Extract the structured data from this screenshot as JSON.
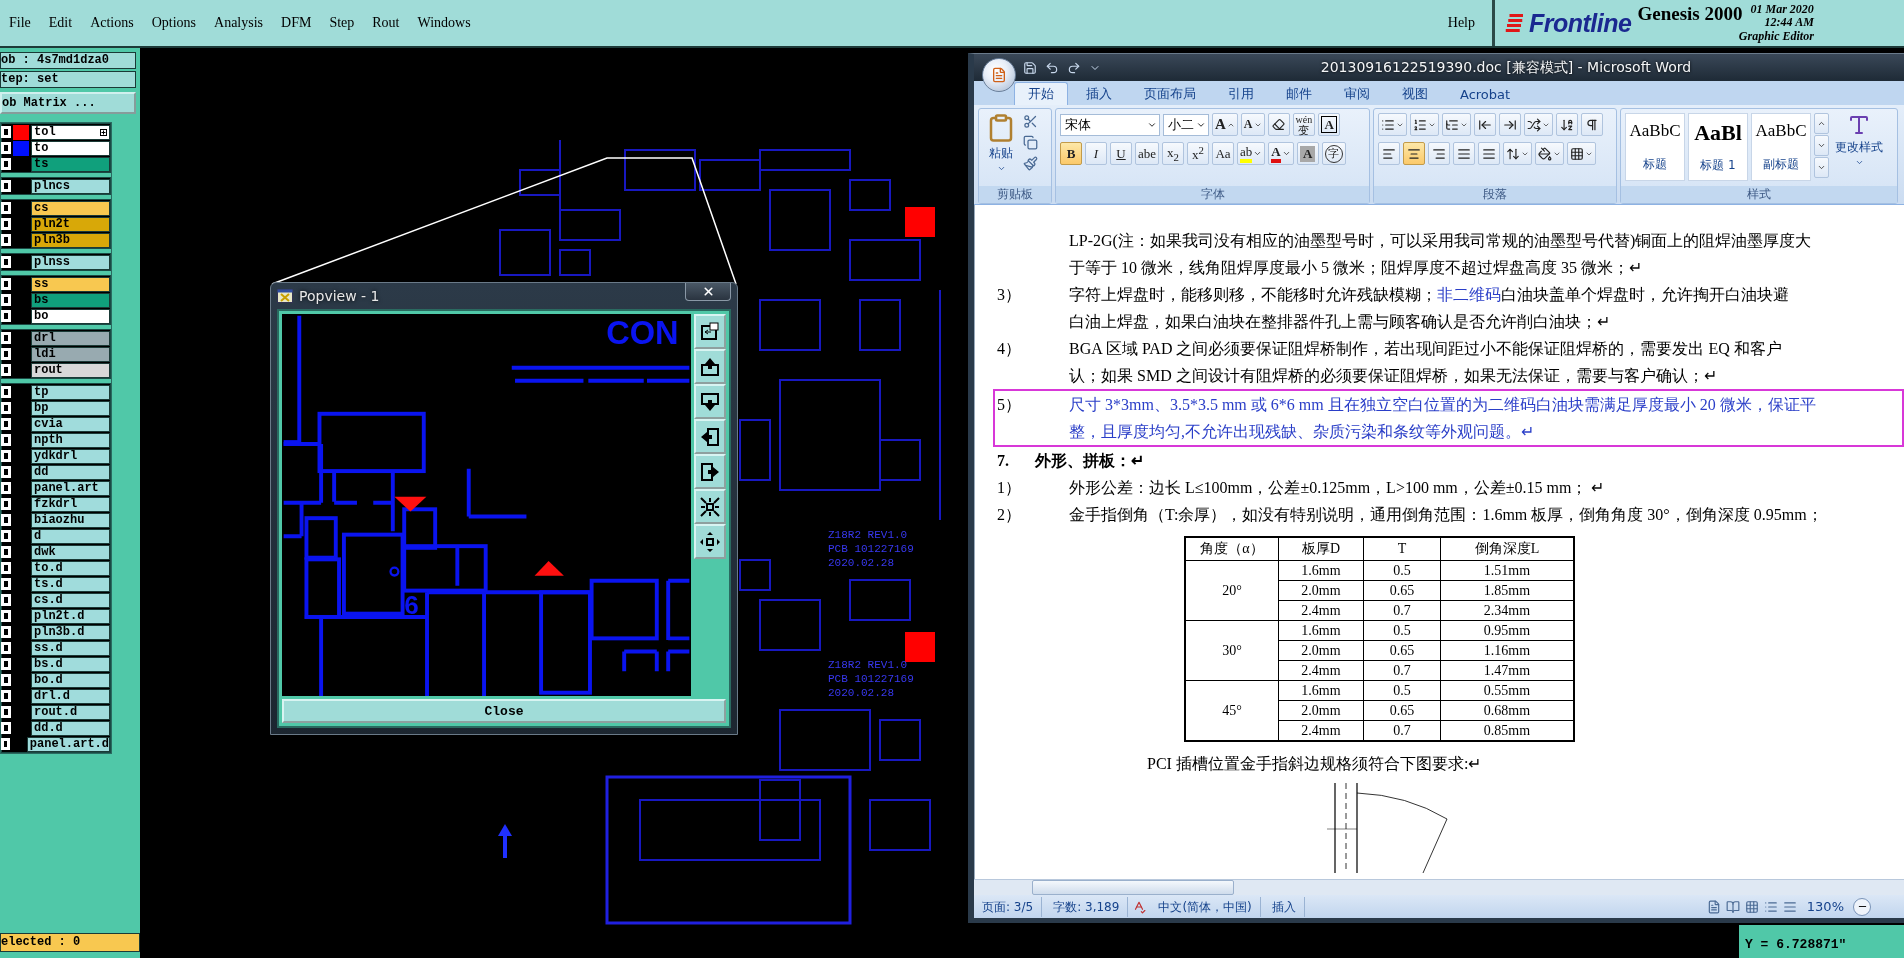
{
  "menu_bar": {
    "items": [
      "File",
      "Edit",
      "Actions",
      "Options",
      "Analysis",
      "DFM",
      "Step",
      "Rout",
      "Windows"
    ],
    "help": "Help"
  },
  "brand": {
    "logo": "Frontline",
    "product": "Genesis 2000",
    "date": "01 Mar 2020",
    "time": "12:44 AM",
    "subtitle": "Graphic Editor"
  },
  "left_panel": {
    "job": "ob : 4s7md1dza0",
    "step": "tep: set",
    "matrix_button": "ob Matrix ...",
    "layer_groups": [
      [
        {
          "name": "tol",
          "color": "#ffffff",
          "swatch": {
            "color": "#ff0000"
          },
          "expander": true,
          "checked": false
        },
        {
          "name": "to",
          "color": "#ffffff",
          "swatch": {
            "color": "#0010ff"
          },
          "expander": false,
          "checked": false
        },
        {
          "name": "ts",
          "color": "#10a07c",
          "expander": false,
          "checked": false
        }
      ],
      [
        {
          "name": "plncs",
          "color": "#a0dcdc",
          "expander": false,
          "checked": false
        }
      ],
      [
        {
          "name": "cs",
          "color": "#f8c850",
          "expander": false,
          "checked": false
        },
        {
          "name": "pln2t",
          "color": "#d8a808",
          "expander": false,
          "checked": false
        },
        {
          "name": "pln3b",
          "color": "#d8a808",
          "expander": false,
          "checked": false
        }
      ],
      [
        {
          "name": "plnss",
          "color": "#a0dcdc",
          "expander": false,
          "checked": false
        }
      ],
      [
        {
          "name": "ss",
          "color": "#f8c850",
          "expander": false,
          "checked": false
        },
        {
          "name": "bs",
          "color": "#10a07c",
          "expander": false,
          "checked": false
        },
        {
          "name": "bo",
          "color": "#ffffff",
          "expander": false,
          "checked": false
        }
      ],
      [
        {
          "name": "drl",
          "color": "#98aab0",
          "expander": false,
          "checked": false
        },
        {
          "name": "ldi",
          "color": "#98aab0",
          "expander": false,
          "checked": false
        },
        {
          "name": "rout",
          "color": "#d8d8d8",
          "expander": false,
          "checked": false
        }
      ],
      [
        {
          "name": "tp",
          "color": "#a0dcdc",
          "expander": false,
          "checked": false
        },
        {
          "name": "bp",
          "color": "#a0dcdc",
          "expander": false,
          "checked": false
        },
        {
          "name": "cvia",
          "color": "#a0dcdc",
          "expander": false,
          "checked": false
        },
        {
          "name": "npth",
          "color": "#a0dcdc",
          "expander": false,
          "checked": false
        },
        {
          "name": "ydkdrl",
          "color": "#a0dcdc",
          "expander": false,
          "checked": false
        },
        {
          "name": "dd",
          "color": "#a0dcdc",
          "expander": false,
          "checked": false
        },
        {
          "name": "panel.art",
          "color": "#a0dcdc",
          "expander": false,
          "checked": false
        },
        {
          "name": "fzkdrl",
          "color": "#a0dcdc",
          "expander": false,
          "checked": false
        },
        {
          "name": "biaozhu",
          "color": "#a0dcdc",
          "expander": false,
          "checked": false
        },
        {
          "name": "d",
          "color": "#a0dcdc",
          "expander": false,
          "checked": false
        },
        {
          "name": "dwk",
          "color": "#a0dcdc",
          "expander": false,
          "checked": false
        },
        {
          "name": "to.d",
          "color": "#a0dcdc",
          "expander": false,
          "checked": false
        },
        {
          "name": "ts.d",
          "color": "#a0dcdc",
          "expander": false,
          "checked": false
        },
        {
          "name": "cs.d",
          "color": "#a0dcdc",
          "expander": false,
          "checked": false
        },
        {
          "name": "pln2t.d",
          "color": "#a0dcdc",
          "expander": false,
          "checked": false
        },
        {
          "name": "pln3b.d",
          "color": "#a0dcdc",
          "expander": false,
          "checked": false
        },
        {
          "name": "ss.d",
          "color": "#a0dcdc",
          "expander": false,
          "checked": false
        },
        {
          "name": "bs.d",
          "color": "#a0dcdc",
          "expander": false,
          "checked": false
        },
        {
          "name": "bo.d",
          "color": "#a0dcdc",
          "expander": false,
          "checked": false
        },
        {
          "name": "drl.d",
          "color": "#a0dcdc",
          "expander": false,
          "checked": false
        },
        {
          "name": "rout.d",
          "color": "#a0dcdc",
          "expander": false,
          "checked": false
        },
        {
          "name": "dd.d",
          "color": "#a0dcdc",
          "expander": false,
          "checked": false
        },
        {
          "name": "panel.art.d",
          "color": "#a0dcdc",
          "expander": false,
          "checked": false
        }
      ]
    ],
    "selected": "elected : 0"
  },
  "canvas": {
    "board_labels": [
      {
        "lines": [
          "Z18R2 REV1.0",
          "PCB 101227169",
          "2020.02.28"
        ]
      },
      {
        "lines": [
          "Z18R2 REV1.0",
          "PCB 101227169",
          "2020.02.28"
        ]
      }
    ]
  },
  "popview": {
    "title": "Popview - 1",
    "labels": [
      "CON",
      "6"
    ],
    "close_button": "Close"
  },
  "word": {
    "title": "20130916122519390.doc [兼容模式] - Microsoft Word",
    "tabs": [
      {
        "label": "开始",
        "selected": true
      },
      {
        "label": "插入",
        "selected": false
      },
      {
        "label": "页面布局",
        "selected": false
      },
      {
        "label": "引用",
        "selected": false
      },
      {
        "label": "邮件",
        "selected": false
      },
      {
        "label": "审阅",
        "selected": false
      },
      {
        "label": "视图",
        "selected": false
      },
      {
        "label": "Acrobat",
        "selected": false
      }
    ],
    "ribbon": {
      "clipboard": {
        "label": "剪贴板",
        "paste": "粘贴"
      },
      "font": {
        "label": "字体",
        "name": "宋体",
        "size": "小二",
        "size_buttons": [
          "A",
          "A"
        ],
        "phonetic": "wén",
        "phonetic_base": "变",
        "border_button": "A",
        "toggles": [
          {
            "text": "B",
            "kind": "bold",
            "on": true
          },
          {
            "text": "I",
            "kind": "italic",
            "on": false
          },
          {
            "text": "U",
            "kind": "underline",
            "on": false
          },
          {
            "text": "abe",
            "kind": "strike",
            "on": false
          },
          {
            "text": "x$_{2}$",
            "kind": "plain",
            "on": false
          },
          {
            "text": "x$^{2}$",
            "kind": "plain",
            "on": false
          },
          {
            "text": "Aa",
            "kind": "plain",
            "on": false
          }
        ],
        "color_buttons": [
          {
            "text": "ab",
            "kind": "highlight"
          },
          {
            "text": "A",
            "kind": "font-color"
          },
          {
            "text": "A",
            "kind": "shading"
          },
          {
            "text": "字",
            "kind": "enclose"
          }
        ]
      },
      "paragraph": {
        "label": "段落",
        "alignments": [
          {
            "kind": "left",
            "selected": false
          },
          {
            "kind": "center",
            "selected": true
          },
          {
            "kind": "right",
            "selected": false
          },
          {
            "kind": "justify",
            "selected": false
          },
          {
            "kind": "distributed",
            "selected": false
          }
        ]
      },
      "styles": {
        "label": "样式",
        "items": [
          {
            "preview": "AaBbC",
            "label": "标题",
            "kind": "title"
          },
          {
            "preview": "AaBl",
            "label": "标题 1",
            "kind": "heading"
          },
          {
            "preview": "AaBbC",
            "label": "副标题",
            "kind": "subtitle"
          }
        ],
        "change": "更改样式"
      }
    },
    "document": {
      "paragraphs": [
        {
          "kind": "continuation",
          "framed": false,
          "lines": [
            [
              {
                "text": "LP-2G(注：如果我司没有相应的油墨型号时，可以采用我司常规的油墨型号代替)铜面上的阻焊油墨厚度大",
                "blue": false
              }
            ],
            [
              {
                "text": "于等于 10 微米，线角阻焊厚度最小 5 微米；阻焊厚度不超过焊盘高度 35 微米；↵",
                "blue": false
              }
            ]
          ]
        },
        {
          "kind": "item",
          "number": "3）",
          "framed": false,
          "lines": [
            [
              {
                "text": "字符上焊盘时，能移则移，不能移时允许残缺模糊；",
                "blue": false
              },
              {
                "text": "非二维码",
                "blue": true
              },
              {
                "text": "白油块盖单个焊盘时，允许掏开白油块避",
                "blue": false
              }
            ],
            [
              {
                "text": "白油上焊盘，如果白油块在整排器件孔上需与顾客确认是否允许削白油块；↵",
                "blue": false
              }
            ]
          ]
        },
        {
          "kind": "item",
          "number": "4）",
          "framed": false,
          "lines": [
            [
              {
                "text": "BGA 区域 PAD 之间必须要保证阻焊桥制作，若出现间距过小不能保证阻焊桥的，需要发出 EQ 和客户",
                "blue": false
              }
            ],
            [
              {
                "text": "认；如果 SMD 之间设计有阻焊桥的必须要保证阻焊桥，如果无法保证，需要与客户确认；↵",
                "blue": false
              }
            ]
          ]
        },
        {
          "kind": "item",
          "number": "5）",
          "framed": true,
          "lines": [
            [
              {
                "text": "尺寸 3*3mm、3.5*3.5 mm 或 6*6 mm 且在独立空白位置的为二维码白油块需满足厚度最小 20 微米，保证平",
                "blue": true
              }
            ],
            [
              {
                "text": "整，且厚度均匀,不允许出现残缺、杂质污染和条纹等外观问题。↵",
                "blue": true
              }
            ]
          ]
        },
        {
          "kind": "heading",
          "number": "7.",
          "framed": false,
          "lines": [
            [
              {
                "text": "外形、拼板：↵",
                "blue": false
              }
            ]
          ]
        },
        {
          "kind": "item",
          "number": "1）",
          "framed": false,
          "lines": [
            [
              {
                "text": "外形公差：边长 L≤100mm，公差±0.125mm，L>100  mm，公差±0.15  mm；  ↵",
                "blue": false
              }
            ]
          ]
        },
        {
          "kind": "item",
          "number": "2）",
          "framed": false,
          "lines": [
            [
              {
                "text": "金手指倒角（T:余厚），如没有特别说明，通用倒角范围：1.6mm 板厚，倒角角度 30°，倒角深度 0.95mm；",
                "blue": false
              }
            ]
          ]
        }
      ],
      "table": {
        "columns": [
          "角度（α）",
          "板厚D",
          "T",
          "倒角深度L"
        ],
        "groups": [
          {
            "angle": "20°",
            "rows": [
              [
                "1.6mm",
                "0.5",
                "1.51mm"
              ],
              [
                "2.0mm",
                "0.65",
                "1.85mm"
              ],
              [
                "2.4mm",
                "0.7",
                "2.34mm"
              ]
            ]
          },
          {
            "angle": "30°",
            "rows": [
              [
                "1.6mm",
                "0.5",
                "0.95mm"
              ],
              [
                "2.0mm",
                "0.65",
                "1.16mm"
              ],
              [
                "2.4mm",
                "0.7",
                "1.47mm"
              ]
            ]
          },
          {
            "angle": "45°",
            "rows": [
              [
                "1.6mm",
                "0.5",
                "0.55mm"
              ],
              [
                "2.0mm",
                "0.65",
                "0.68mm"
              ],
              [
                "2.4mm",
                "0.7",
                "0.85mm"
              ]
            ]
          }
        ]
      },
      "caption": "PCI 插槽位置金手指斜边规格须符合下图要求:↵"
    },
    "status_bar": [
      {
        "text": "页面: 3/5",
        "kind": "text"
      },
      {
        "text": "字数: 3,189",
        "kind": "text"
      },
      {
        "text": "中文(简体，中国)",
        "kind": "language"
      },
      {
        "text": "插入",
        "kind": "text"
      }
    ],
    "zoom": "130%"
  },
  "coordinates": {
    "y": "Y = 6.728871\""
  }
}
